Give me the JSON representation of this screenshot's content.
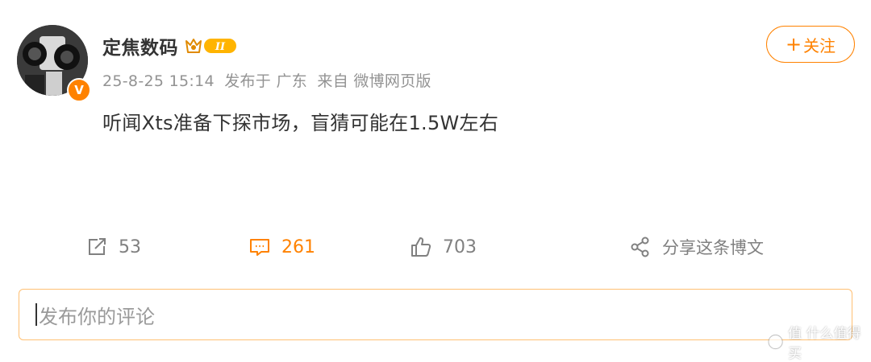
{
  "post": {
    "username": "定焦数码",
    "member_level": "II",
    "time": "25-8-25 15:14",
    "location": "发布于 广东",
    "source": "来自 微博网页版",
    "content": "听闻Xts准备下探市场，盲猜可能在1.5W左右",
    "follow_label": "关注",
    "follow_plus": "+",
    "verified_mark": "V"
  },
  "actions": {
    "repost_count": "53",
    "comment_count": "261",
    "like_count": "703",
    "share_label": "分享这条博文"
  },
  "comment_input": {
    "placeholder": "发布你的评论"
  },
  "watermark": {
    "text": "值 什么值得买"
  },
  "colors": {
    "accent": "#ff8200",
    "text": "#333333",
    "meta": "#939393",
    "icon": "#808080"
  },
  "icons": [
    "repost-icon",
    "comment-icon",
    "like-icon",
    "share-icon",
    "member-crown-icon",
    "verified-icon"
  ]
}
